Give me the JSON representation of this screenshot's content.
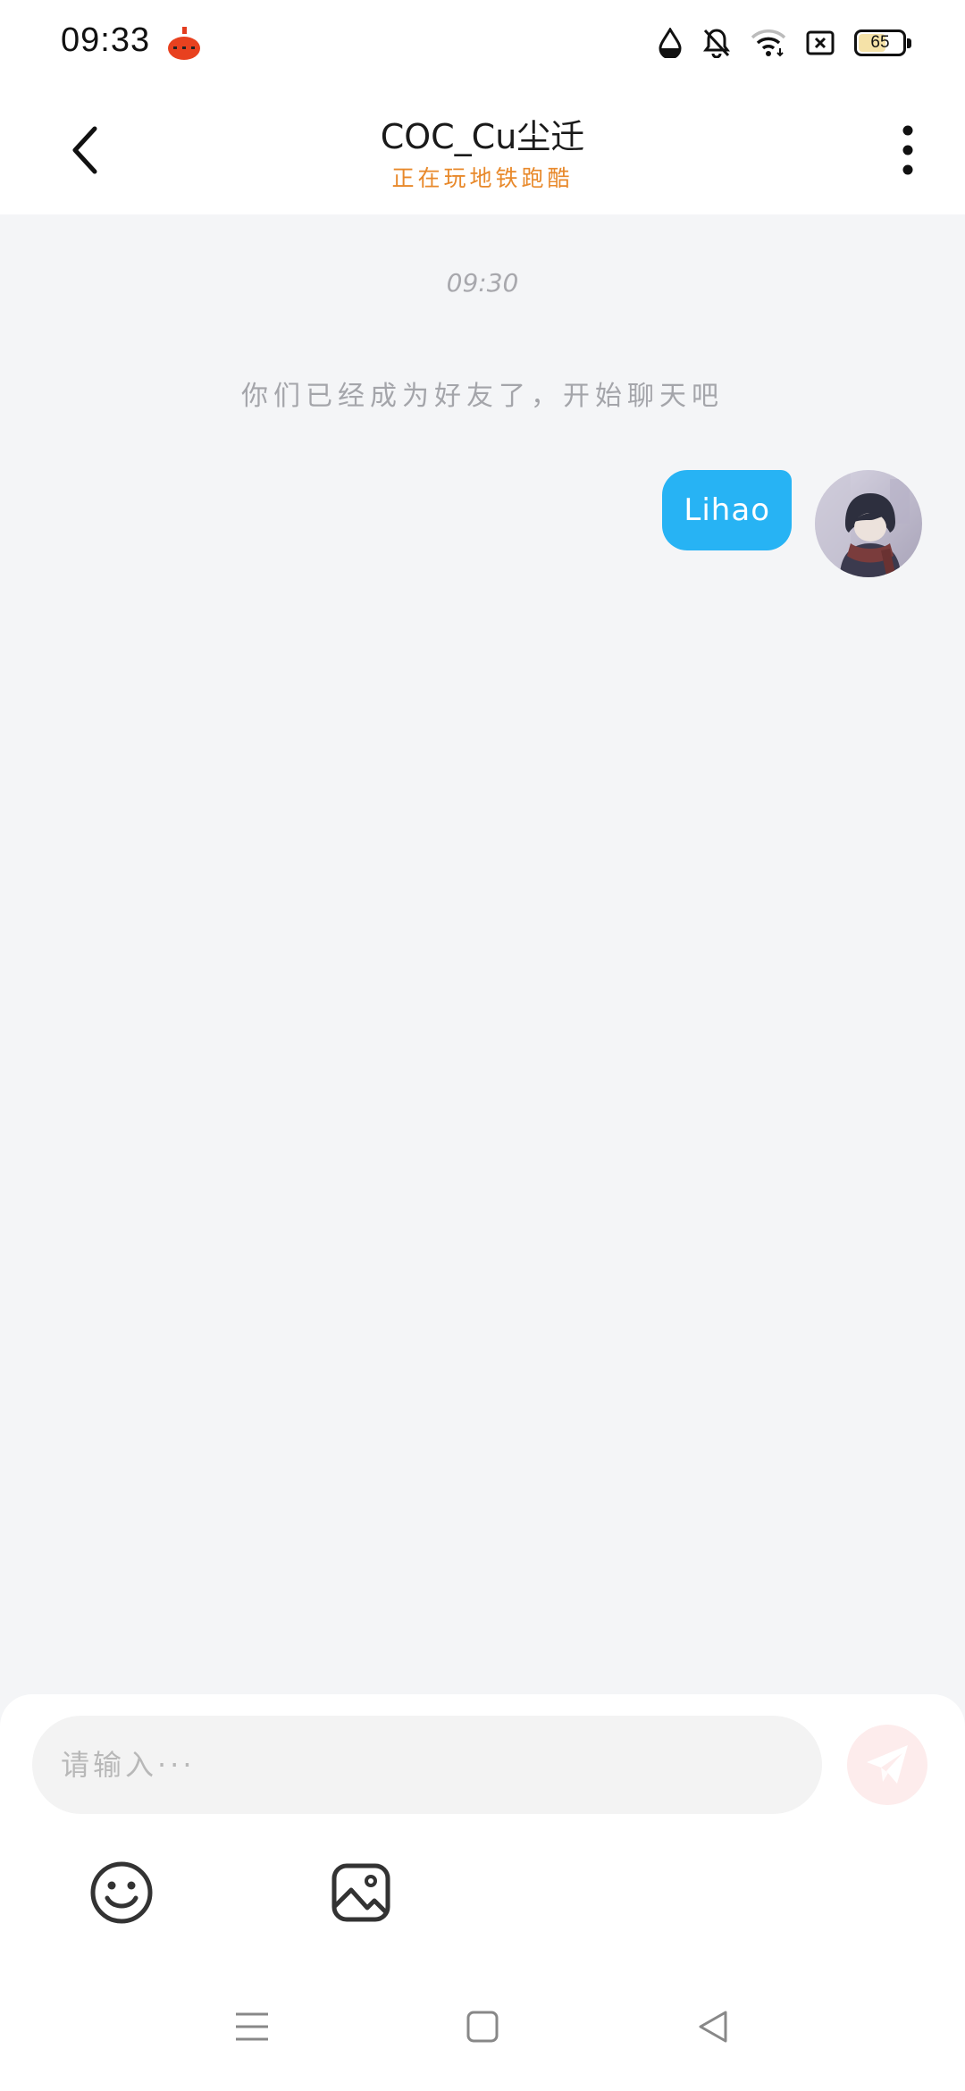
{
  "status_bar": {
    "time": "09:33",
    "battery_level": "65",
    "battery_fraction": 0.65,
    "icons": [
      "app-notification-icon",
      "data-saver-icon",
      "bell-muted-icon",
      "wifi-icon",
      "sim-off-icon",
      "battery-icon"
    ]
  },
  "header": {
    "title": "COC_Cu尘迁",
    "subtitle": "正在玩地铁跑酷",
    "back_icon": "chevron-left-icon",
    "more_icon": "more-vertical-icon"
  },
  "chat": {
    "timestamp": "09:30",
    "system_notice": "你们已经成为好友了，开始聊天吧",
    "messages": [
      {
        "sender": "self",
        "text": "Lihao"
      }
    ]
  },
  "composer": {
    "placeholder": "请输入···",
    "value": "",
    "send_icon": "send-icon",
    "emoji_icon": "emoji-icon",
    "image_icon": "image-icon"
  },
  "nav_bar": {
    "items": [
      "menu-icon",
      "home-icon",
      "back-triangle-icon"
    ]
  },
  "colors": {
    "bubble": "#27b3f4",
    "subtitle": "#e8892b",
    "background": "#f4f5f7",
    "send_button": "#fdecec"
  }
}
